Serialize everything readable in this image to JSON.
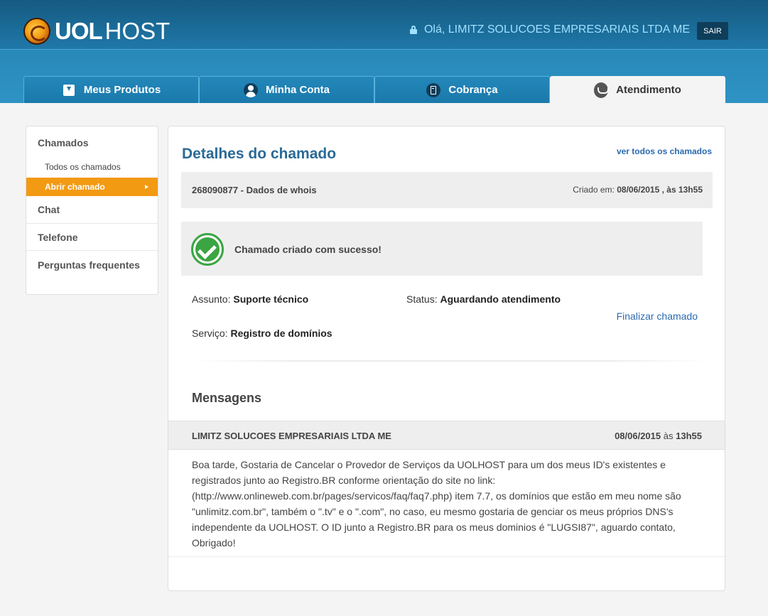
{
  "header": {
    "logo_uol": "UOL",
    "logo_host": "HOST",
    "greeting": "Olá, LIMITZ SOLUCOES EMPRESARIAIS LTDA ME",
    "logout_label": "SAIR"
  },
  "nav": {
    "tabs": [
      {
        "label": "Meus Produtos",
        "icon": "download-box-icon"
      },
      {
        "label": "Minha Conta",
        "icon": "user-icon"
      },
      {
        "label": "Cobrança",
        "icon": "calculator-icon"
      },
      {
        "label": "Atendimento",
        "icon": "handshake-icon",
        "active": true
      }
    ]
  },
  "sidebar": {
    "heading": "Chamados",
    "sub_items": [
      "Todos os chamados",
      "Abrir chamado"
    ],
    "items": [
      "Chat",
      "Telefone",
      "Perguntas frequentes"
    ]
  },
  "main": {
    "title": "Detalhes do chamado",
    "see_all": "ver todos os chamados",
    "ticket": {
      "id_title": "268090877 - Dados de whois",
      "created_label": "Criado em:",
      "created_date": "08/06/2015 , às 13h55"
    },
    "success_message": "Chamado criado com sucesso!",
    "fields": {
      "subject_label": "Assunto:",
      "subject_value": "Suporte técnico",
      "status_label": "Status:",
      "status_value": "Aguardando atendimento",
      "service_label": "Serviço:",
      "service_value": "Registro de domínios"
    },
    "finalize_label": "Finalizar chamado",
    "messages_title": "Mensagens",
    "message": {
      "author": "LIMITZ SOLUCOES EMPRESARIAIS LTDA ME",
      "date": "08/06/2015",
      "date_sep": "às",
      "time": "13h55",
      "body": "Boa tarde, Gostaria de Cancelar o Provedor de Serviços da UOLHOST para um dos meus ID's existentes e registrados junto ao Registro.BR conforme orientação do site no link: (http://www.onlineweb.com.br/pages/servicos/faq/faq7.php) item 7.7, os domínios que estão em meu nome são \"unlimitz.com.br\", também o \".tv\" e o \".com\", no caso, eu mesmo gostaria de genciar os meus próprios DNS's independente da UOLHOST. O ID junto a Registro.BR para os meus dominios é \"LUGSI87\", aguardo contato, Obrigado!"
    }
  },
  "colors": {
    "header_blue": "#1f78a8",
    "accent_orange": "#f39a13",
    "title_blue": "#2a6a96",
    "link_blue": "#2a6ab0",
    "success_green": "#3aa542"
  }
}
